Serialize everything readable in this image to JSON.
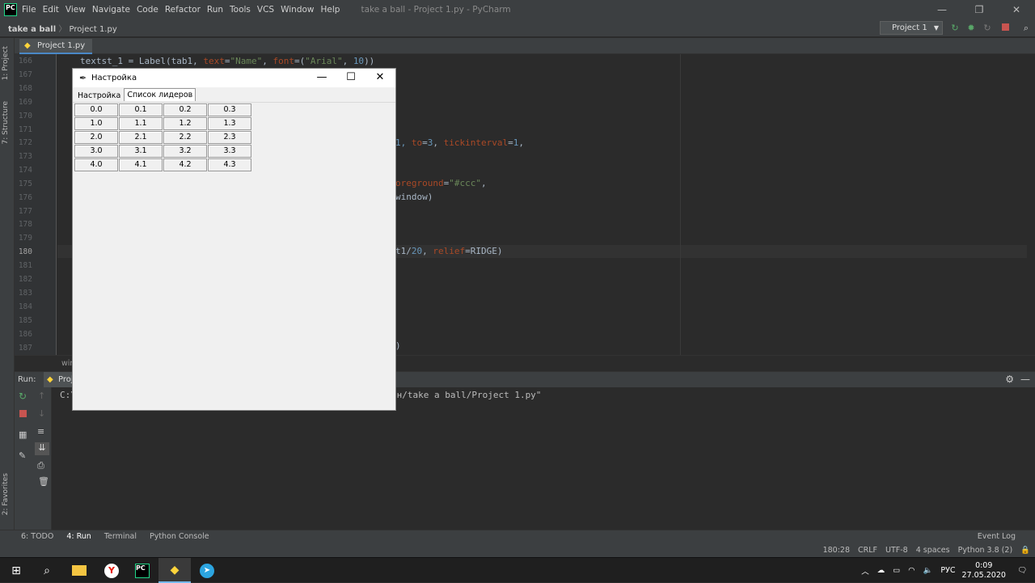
{
  "ide": {
    "menu": [
      "File",
      "Edit",
      "View",
      "Navigate",
      "Code",
      "Refactor",
      "Run",
      "Tools",
      "VCS",
      "Window",
      "Help"
    ],
    "window_title": "take a ball - Project 1.py - PyCharm",
    "breadcrumb": {
      "project": "take a ball",
      "file": "Project 1.py"
    },
    "run_config": "Project 1",
    "open_tab": "Project 1.py",
    "left_tools": [
      "1: Project",
      "7: Structure",
      "2: Favorites"
    ],
    "line_numbers": [
      "166",
      "167",
      "168",
      "169",
      "170",
      "171",
      "172",
      "173",
      "174",
      "175",
      "176",
      "177",
      "178",
      "179",
      "180",
      "181",
      "182",
      "183",
      "184",
      "185",
      "186",
      "187"
    ],
    "code": {
      "l166_a": "textst_1 = Label(tab1, ",
      "l166_p1": "text",
      "l166_b": "=",
      "l166_s1": "\"Name\"",
      "l166_c": ", ",
      "l166_p2": "font",
      "l166_d": "=(",
      "l166_s2": "\"Arial\"",
      "l166_e": ", ",
      "l166_n": "10",
      "l166_f": "))",
      "l172_a": "1, ",
      "l172_p1": "to",
      "l172_b": "=",
      "l172_n1": "3",
      "l172_c": ", ",
      "l172_p2": "tickinterval",
      "l172_d": "=",
      "l172_n2": "1",
      "l172_e": ",",
      "l175_p": "oreground",
      "l175_b": "=",
      "l175_s": "\"#ccc\"",
      "l175_c": ",",
      "l176": "window)",
      "l180_a": "t1/",
      "l180_n": "20",
      "l180_b": ", ",
      "l180_p": "relief",
      "l180_c": "=RIDGE)",
      "l187": ")"
    },
    "crumb_text": "win",
    "run": {
      "label": "Run:",
      "tab": "Proj",
      "console_prefix": "C:\\",
      "console_suffix": "он/take a ball/Project 1.py\""
    },
    "tool_windows": [
      "6: TODO",
      "4: Run",
      "Terminal",
      "Python Console"
    ],
    "event_log": "Event Log",
    "status": [
      "180:28",
      "CRLF",
      "UTF-8",
      "4 spaces",
      "Python 3.8 (2)"
    ]
  },
  "taskbar": {
    "lang": "РУС",
    "time": "0:09",
    "date": "27.05.2020"
  },
  "tk": {
    "title": "Настройка",
    "tabs": [
      "Настройка",
      "Список лидеров"
    ],
    "grid": [
      [
        "0.0",
        "0.1",
        "0.2",
        "0.3"
      ],
      [
        "1.0",
        "1.1",
        "1.2",
        "1.3"
      ],
      [
        "2.0",
        "2.1",
        "2.2",
        "2.3"
      ],
      [
        "3.0",
        "3.1",
        "3.2",
        "3.3"
      ],
      [
        "4.0",
        "4.1",
        "4.2",
        "4.3"
      ]
    ]
  }
}
